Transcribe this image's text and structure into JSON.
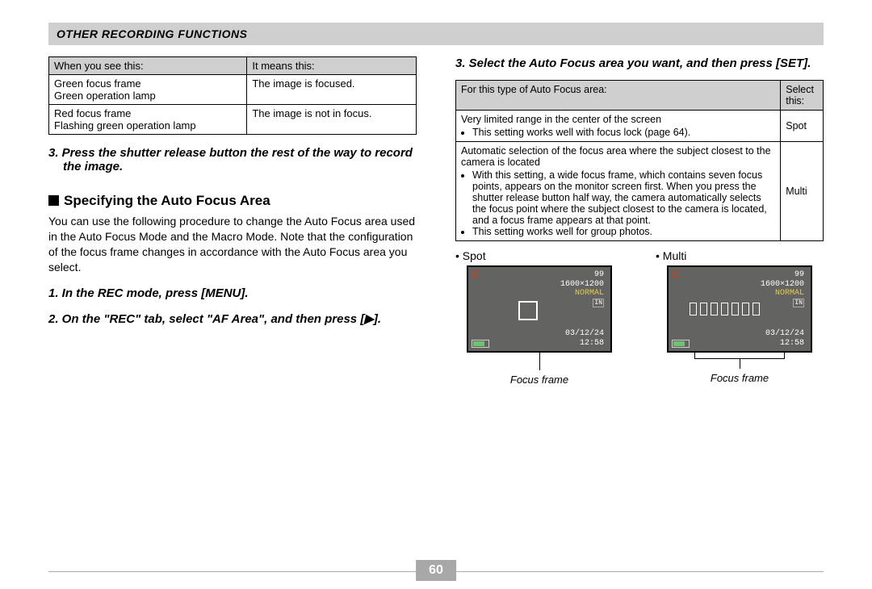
{
  "banner": "OTHER RECORDING FUNCTIONS",
  "focusTable": {
    "head": {
      "c1": "When you see this:",
      "c2": "It means this:"
    },
    "rows": [
      {
        "c1": "Green focus frame\nGreen operation lamp",
        "c2": "The image is focused."
      },
      {
        "c1": "Red focus frame\nFlashing green operation lamp",
        "c2": "The image is not in focus."
      }
    ]
  },
  "leftSteps": {
    "s3": "3. Press the shutter release button the rest of the way to record the image."
  },
  "afSection": {
    "heading": "Specifying the Auto Focus Area",
    "body": "You can use the following procedure to change the Auto Focus area used in the Auto Focus Mode and the Macro Mode. Note that the configuration of the focus frame changes in accordance with the Auto Focus area you select.",
    "steps": {
      "s1": "1. In the REC mode, press [MENU].",
      "s2": "2. On the \"REC\" tab, select \"AF Area\", and then press [▶].",
      "s3": "3. Select the Auto Focus area you want, and then press [SET]."
    }
  },
  "afTable": {
    "head": {
      "c1": "For this type of Auto Focus area:",
      "c2": "Select this:"
    },
    "rows": [
      {
        "desc": "Very limited range in the center of the screen",
        "bullet1": "This setting works well with focus lock (page 64).",
        "sel": "Spot"
      },
      {
        "desc": "Automatic selection of the focus area where the subject closest to the camera is located",
        "bullet1": "With this setting, a wide focus frame, which contains seven focus points, appears on the monitor screen first. When you press the shutter release button half way, the camera automatically selects the focus point where the subject closest to the camera is located, and a focus frame appears at that point.",
        "bullet2": "This setting works well for group photos.",
        "sel": "Multi"
      }
    ]
  },
  "camLabels": {
    "spot": "• Spot",
    "multi": "• Multi"
  },
  "lcd": {
    "num": "99",
    "res": "1600×1200",
    "norm": "NORMAL",
    "date": "03/12/24",
    "time": "12:58"
  },
  "focusFrameCaption": "Focus frame",
  "pageNumber": "60"
}
